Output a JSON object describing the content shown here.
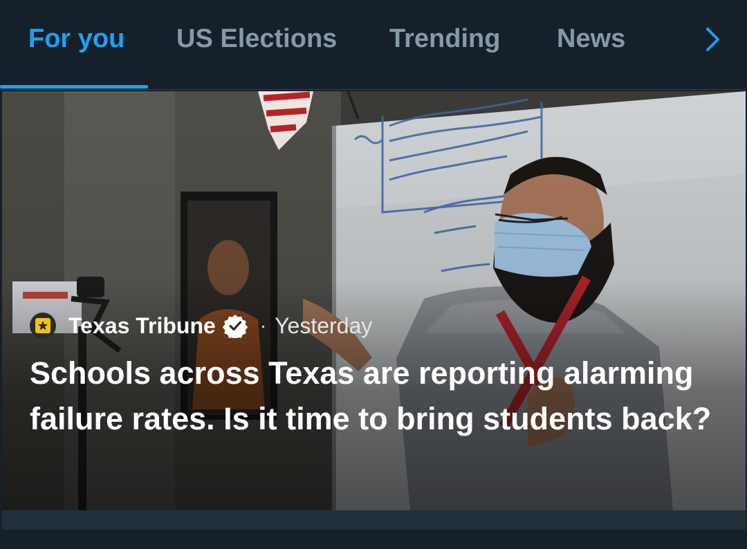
{
  "tabs": [
    {
      "label": "For you",
      "active": true
    },
    {
      "label": "US Elections",
      "active": false
    },
    {
      "label": "Trending",
      "active": false
    },
    {
      "label": "News",
      "active": false
    }
  ],
  "next_icon": "chevron-right-icon",
  "colors": {
    "background": "#15202b",
    "accent": "#1da1f2",
    "inactive_tab": "#8899a6",
    "divider": "#38444d"
  },
  "hero": {
    "source": {
      "name": "Texas Tribune",
      "logo_icon": "star-square-icon",
      "verified_icon": "verified-badge-icon"
    },
    "separator": "·",
    "time": "Yesterday",
    "headline": "Schools across Texas are reporting alarming failure rates. Is it time to bring students back?"
  }
}
